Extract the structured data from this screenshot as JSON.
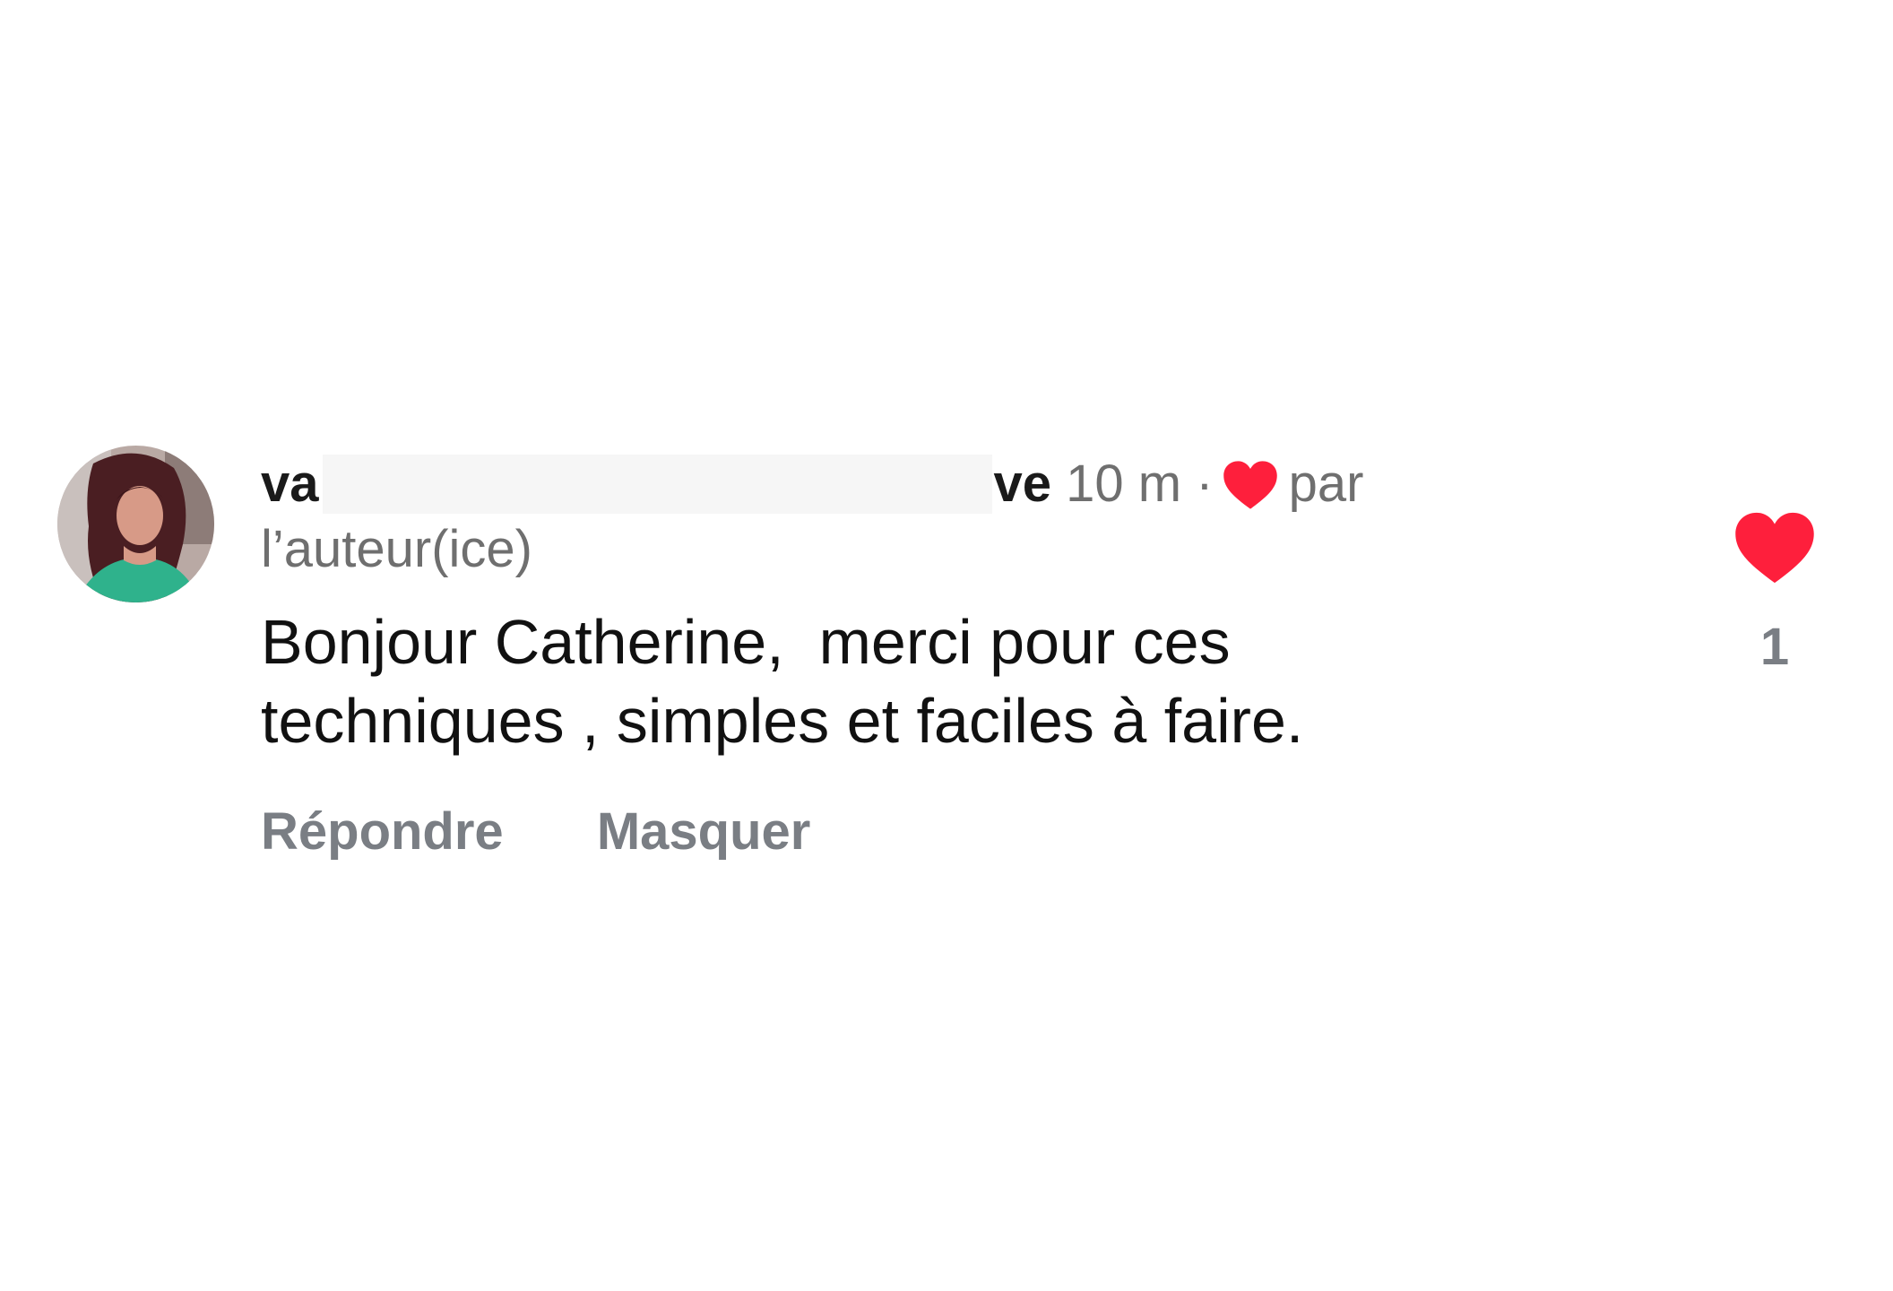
{
  "comment": {
    "author": {
      "name_visible_start": "va",
      "name_visible_end": "ve",
      "avatar_icon": "user-avatar-photo"
    },
    "time_ago": "10 m",
    "separator": "·",
    "author_like_prefix": "par",
    "author_like_suffix": "l’auteur(ice)",
    "body_lines": [
      "Bonjour Catherine,  merci pour ces",
      "techniques , simples et faciles à faire."
    ],
    "actions": {
      "reply_label": "Répondre",
      "hide_label": "Masquer"
    },
    "likes": {
      "count": "1",
      "icon": "heart-icon",
      "color": "#fe1f3c"
    }
  },
  "colors": {
    "heart": "#fe1f3c",
    "text_primary": "#111111",
    "text_secondary": "#6f6f6f",
    "action_text": "#7a7e84"
  }
}
